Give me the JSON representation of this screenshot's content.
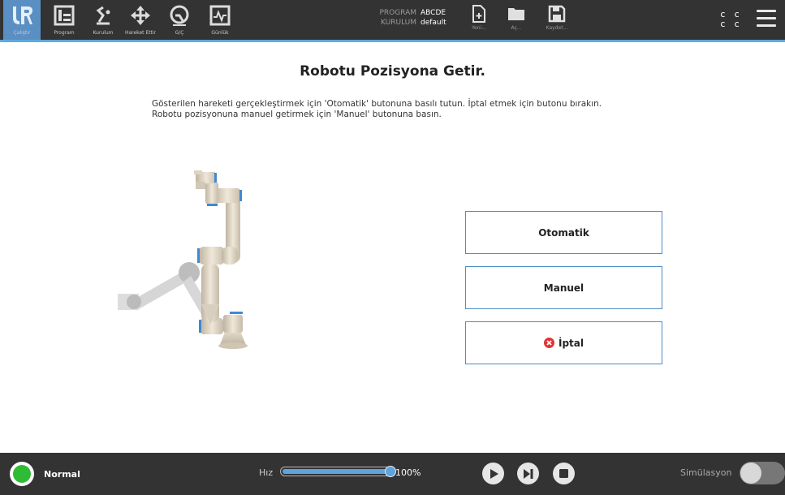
{
  "nav": {
    "items": [
      {
        "label": "Çalıştır",
        "icon": "ur-logo-icon",
        "active": true
      },
      {
        "label": "Program",
        "icon": "program-icon"
      },
      {
        "label": "Kurulum",
        "icon": "installation-icon"
      },
      {
        "label": "Hareket Ettir",
        "icon": "move-icon"
      },
      {
        "label": "G/Ç",
        "icon": "io-icon"
      },
      {
        "label": "Günlük",
        "icon": "log-icon"
      }
    ]
  },
  "program_info": {
    "program_key": "PROGRAM",
    "program_value": "ABCDE",
    "installation_key": "KURULUM",
    "installation_value": "default"
  },
  "file_actions": {
    "new_label": "Yeni...",
    "open_label": "Aç...",
    "save_label": "Kaydet..."
  },
  "control_indicator": "c c\nc c",
  "main": {
    "title": "Robotu Pozisyona Getir.",
    "instructions_line1": "Gösterilen hareketi gerçekleştirmek için 'Otomatik' butonuna basılı tutun. İptal etmek için butonu bırakın.",
    "instructions_line2": "Robotu pozisyonuna manuel getirmek için 'Manuel' butonuna basın.",
    "auto_label": "Otomatik",
    "manual_label": "Manuel",
    "cancel_label": "İptal"
  },
  "footer": {
    "status": "Normal",
    "speed_label": "Hız",
    "speed_value": "100%",
    "speed_fraction": 1.0,
    "simulation_label": "Simülasyon"
  },
  "colors": {
    "topbar": "#333333",
    "accent": "#5ea3dc",
    "status_ok": "#2fbb35",
    "cancel_red": "#e23434"
  }
}
